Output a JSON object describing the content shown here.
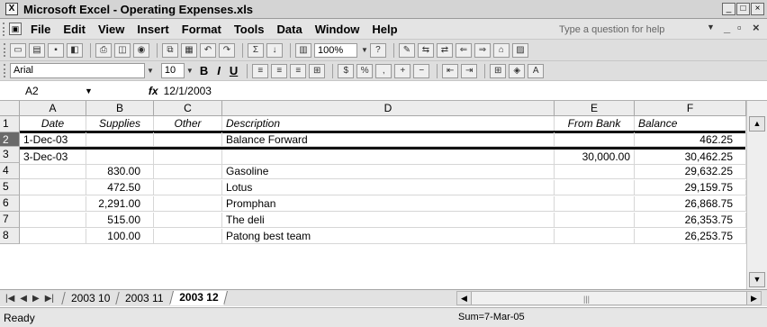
{
  "window": {
    "title": "Microsoft Excel - Operating Expenses.xls",
    "app_icon": "X"
  },
  "menu": {
    "items": [
      "File",
      "Edit",
      "View",
      "Insert",
      "Format",
      "Tools",
      "Data",
      "Window",
      "Help"
    ],
    "help_placeholder": "Type a question for help"
  },
  "toolbar": {
    "zoom": "100%"
  },
  "format_toolbar": {
    "font": "Arial",
    "size": "10",
    "bold": "B",
    "italic": "I",
    "underline": "U"
  },
  "formula_bar": {
    "name_box": "A2",
    "fx": "fx",
    "formula": "12/1/2003"
  },
  "sheet": {
    "columns": [
      "A",
      "B",
      "C",
      "D",
      "E",
      "F"
    ],
    "rows": [
      {
        "num": "1",
        "cells": [
          "Date",
          "Supplies",
          "Other",
          "Description",
          "From Bank",
          "Balance"
        ]
      },
      {
        "num": "2",
        "cells": [
          "1-Dec-03",
          "",
          "",
          "Balance Forward",
          "",
          "462.25"
        ]
      },
      {
        "num": "3",
        "cells": [
          "3-Dec-03",
          "",
          "",
          "",
          "30,000.00",
          "30,462.25"
        ]
      },
      {
        "num": "4",
        "cells": [
          "",
          "830.00",
          "",
          "Gasoline",
          "",
          "29,632.25"
        ]
      },
      {
        "num": "5",
        "cells": [
          "",
          "472.50",
          "",
          "Lotus",
          "",
          "29,159.75"
        ]
      },
      {
        "num": "6",
        "cells": [
          "",
          "2,291.00",
          "",
          "Promphan",
          "",
          "26,868.75"
        ]
      },
      {
        "num": "7",
        "cells": [
          "",
          "515.00",
          "",
          "The deli",
          "",
          "26,353.75"
        ]
      },
      {
        "num": "8",
        "cells": [
          "",
          "100.00",
          "",
          "Patong best team",
          "",
          "26,253.75"
        ]
      }
    ]
  },
  "tabs": [
    "2003 10",
    "2003 11",
    "2003 12"
  ],
  "status": {
    "left": "Ready",
    "sum": "Sum=7-Mar-05"
  }
}
